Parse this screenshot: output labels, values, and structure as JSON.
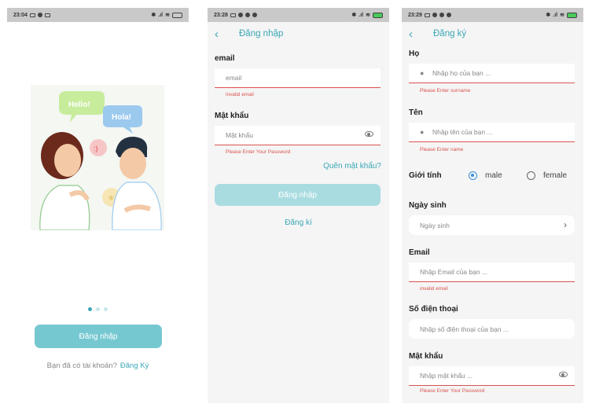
{
  "phone1": {
    "status_time": "23:04",
    "speech_hello": "Hello!",
    "speech_hola": "Hola!",
    "speech_smile": ":)",
    "login_button": "Đăng nhập",
    "footer_text": "Bạn đã có tài khoản?",
    "footer_link": "Đăng Ký"
  },
  "phone2": {
    "status_time": "23:28",
    "back_icon": "‹",
    "title": "Đăng nhập",
    "email_label": "email",
    "email_value": "email",
    "email_error": "invalid email",
    "password_label": "Mật khẩu",
    "password_placeholder": "Mật khẩu",
    "password_error": "Please Enter Your Password",
    "forgot_link": "Quên mật khẩu?",
    "login_button": "Đăng nhập",
    "register_link": "Đăng kí"
  },
  "phone3": {
    "status_time": "23:29",
    "back_icon": "‹",
    "title": "Đăng ký",
    "surname_label": "Họ",
    "surname_placeholder": "Nhập họ của bạn ...",
    "surname_error": "Please Enter surname",
    "name_label": "Tên",
    "name_placeholder": "Nhập tên của bạn ...",
    "name_error": "Please Enter name",
    "gender_label": "Giới tính",
    "gender_male": "male",
    "gender_female": "female",
    "dob_label": "Ngày sinh",
    "dob_value": "Ngày sinh",
    "email_label": "Email",
    "email_placeholder": "Nhập Email của bạn ...",
    "email_error": "invalid email",
    "phone_label": "Số điện thoại",
    "phone_placeholder": "Nhập số điện thoại của bạn ...",
    "password_label": "Mật khẩu",
    "password_placeholder": "Nhập mật khẩu ...",
    "password_error": "Please Enter Your Password"
  },
  "colors": {
    "accent": "#3aa7b5",
    "button": "#76c8d0",
    "error": "#d9534f"
  }
}
